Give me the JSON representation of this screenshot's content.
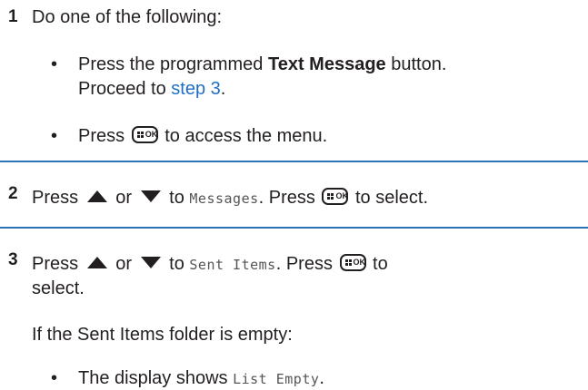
{
  "step1": {
    "number": "1",
    "intro": "Do one of the following:",
    "bullet1": {
      "prefix": "Press the programmed ",
      "bold": "Text Message",
      "suffix": " button.",
      "line2_prefix": "Proceed to ",
      "link": "step 3",
      "line2_suffix": "."
    },
    "bullet2": {
      "prefix": "Press ",
      "suffix": " to access the menu."
    }
  },
  "step2": {
    "number": "2",
    "press": "Press ",
    "or": " or ",
    "to": " to ",
    "menu_item": "Messages",
    "after": ". Press ",
    "suffix": " to select."
  },
  "step3": {
    "number": "3",
    "press": "Press ",
    "or": " or ",
    "to": " to ",
    "menu_item": "Sent Items",
    "after": ". Press ",
    "suffix": " to",
    "line2": "select.",
    "condition": "If the Sent Items folder is empty:",
    "bullet": {
      "prefix": "The display shows ",
      "display_text": "List Empty",
      "suffix": "."
    }
  },
  "colors": {
    "text": "#231f20",
    "link": "#1f6fc5",
    "divider": "#2a73b8",
    "display_text": "#555555"
  },
  "icons": {
    "menu_ok_key": "menu-ok-key-icon",
    "up": "up-arrow-icon",
    "down": "down-arrow-icon"
  }
}
